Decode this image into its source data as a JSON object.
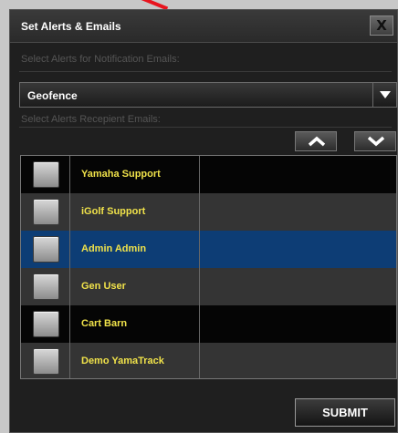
{
  "dialog": {
    "title": "Set Alerts & Emails",
    "close_label": "X"
  },
  "alerts": {
    "label": "Select Alerts for Notification Emails:",
    "selected": "Geofence",
    "dropdown_icon": "chevron-down-icon"
  },
  "recipients": {
    "label": "Select Alerts Recepient Emails:",
    "up_icon": "chevron-up-icon",
    "down_icon": "chevron-down-icon",
    "rows": [
      {
        "name": "Yamaha Support",
        "checked": false,
        "selected": false
      },
      {
        "name": "iGolf Support",
        "checked": false,
        "selected": false
      },
      {
        "name": "Admin Admin",
        "checked": false,
        "selected": true
      },
      {
        "name": "Gen User",
        "checked": false,
        "selected": false
      },
      {
        "name": "Cart Barn",
        "checked": false,
        "selected": false
      },
      {
        "name": "Demo YamaTrack",
        "checked": false,
        "selected": false
      }
    ]
  },
  "submit_label": "SUBMIT",
  "colors": {
    "name_text": "#f0e24a",
    "selected_row": "#0d3d75",
    "annotation_arrow": "#e8141e"
  }
}
